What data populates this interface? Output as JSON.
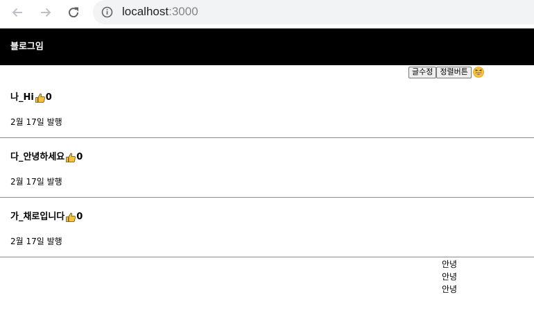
{
  "browser": {
    "url_host": "localhost",
    "url_port": ":3000",
    "icons": [
      "back-icon",
      "forward-icon",
      "reload-icon",
      "info-icon"
    ]
  },
  "header": {
    "title": "블로그임"
  },
  "controls": {
    "edit_label": "글수정",
    "sort_label": "정렬버튼",
    "emoji": "grinning-squint-face"
  },
  "posts": [
    {
      "title": "나_Hi",
      "likes": "0",
      "date": "2월 17일 발행"
    },
    {
      "title": "다_안녕하세요",
      "likes": "0",
      "date": "2월 17일 발행"
    },
    {
      "title": "가_채로입니다",
      "likes": "0",
      "date": "2월 17일 발행"
    }
  ],
  "footer_items": [
    "안녕",
    "안녕",
    "안녕"
  ],
  "colors": {
    "header_bg": "#000000",
    "header_text": "#ffffff",
    "divider": "#8a8a8a",
    "thumb": "#f5c33b"
  }
}
